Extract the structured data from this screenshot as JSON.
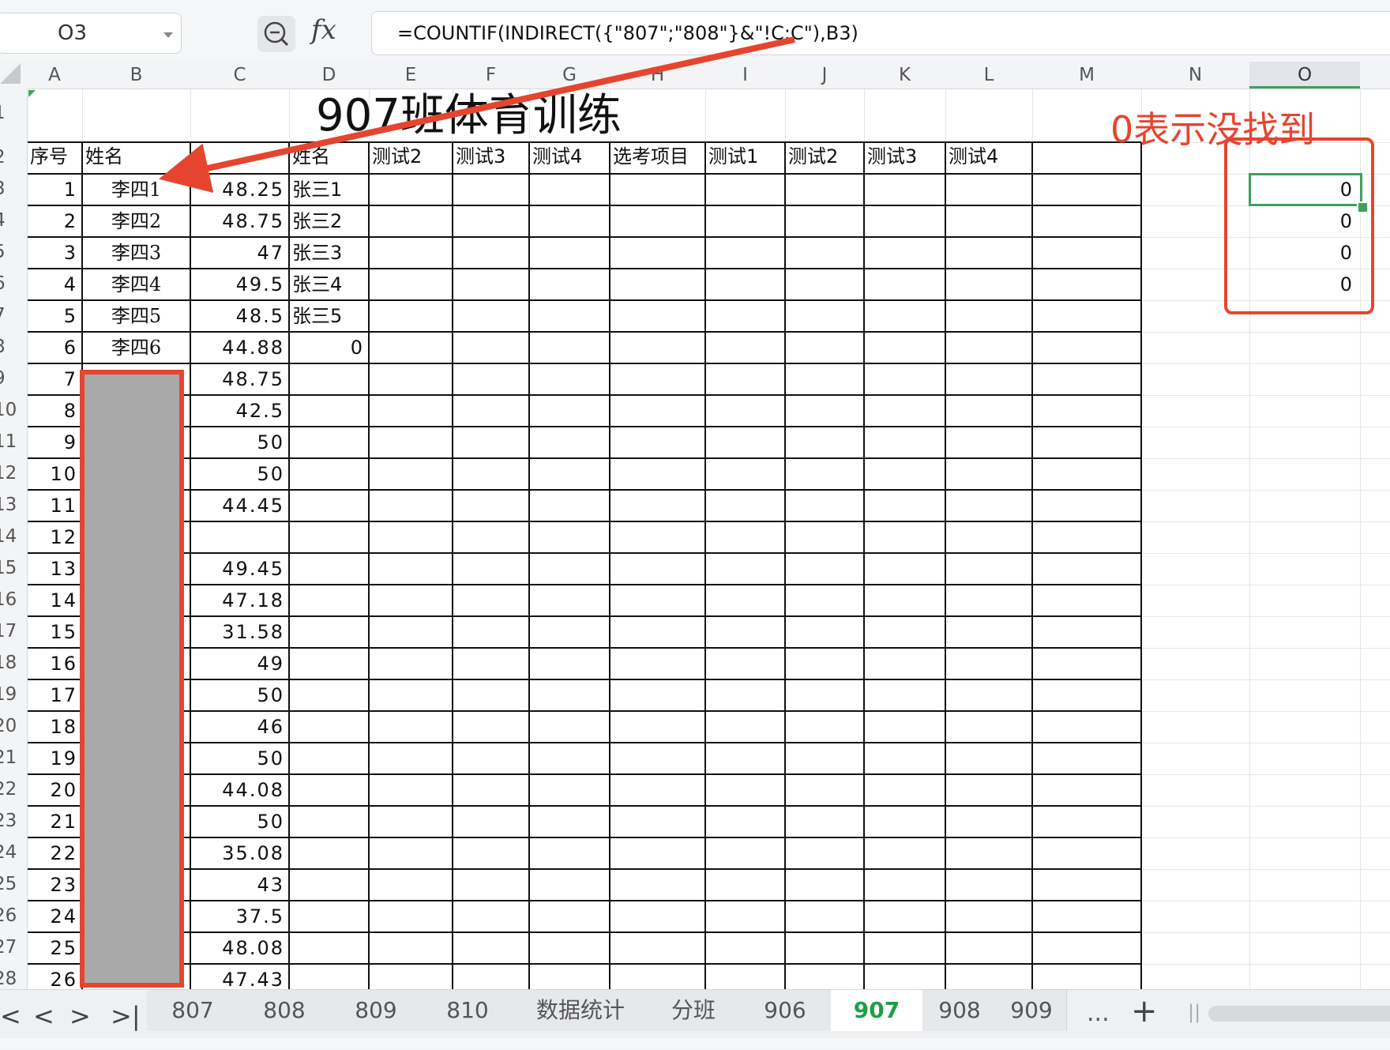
{
  "formula_bar": {
    "cell_ref": "O3",
    "fx_label": "fx",
    "formula": "=COUNTIF(INDIRECT({\"807\";\"808\"}&\"!C:C\"),B3)"
  },
  "columns": [
    "A",
    "B",
    "C",
    "D",
    "E",
    "F",
    "G",
    "H",
    "I",
    "J",
    "K",
    "L",
    "M",
    "N",
    "O"
  ],
  "selected_column": "O",
  "rows": [
    "1",
    "2",
    "3",
    "4",
    "5",
    "6",
    "7",
    "8",
    "9",
    "10",
    "11",
    "12",
    "13",
    "14",
    "15",
    "16",
    "17",
    "18",
    "19",
    "20",
    "21",
    "22",
    "23",
    "24",
    "25",
    "26",
    "27",
    "28"
  ],
  "sheet_title": "907班体育训练",
  "header_row": [
    "序号",
    "姓名",
    "",
    "姓名",
    "测试2",
    "测试3",
    "测试4",
    "选考项目",
    "测试1",
    "测试2",
    "测试3",
    "测试4"
  ],
  "serials": [
    "1",
    "2",
    "3",
    "4",
    "5",
    "6",
    "7",
    "8",
    "9",
    "10",
    "11",
    "12",
    "13",
    "14",
    "15",
    "16",
    "17",
    "18",
    "19",
    "20",
    "21",
    "22",
    "23",
    "24",
    "25",
    "26"
  ],
  "names_b": [
    "李四1",
    "李四2",
    "李四3",
    "李四4",
    "李四5",
    "李四6"
  ],
  "scores_c": [
    "48.25",
    "48.75",
    "47",
    "49.5",
    "48.5",
    "44.88",
    "48.75",
    "42.5",
    "50",
    "50",
    "44.45",
    "",
    "49.45",
    "47.18",
    "31.58",
    "49",
    "50",
    "46",
    "50",
    "44.08",
    "50",
    "35.08",
    "43",
    "37.5",
    "48.08",
    "47.43"
  ],
  "names_d": [
    "张三1",
    "张三2",
    "张三3",
    "张三4",
    "张三5",
    "0"
  ],
  "results_o": [
    "0",
    "0",
    "0",
    "0"
  ],
  "annotation": "0表示没找到",
  "sheet_tabs": [
    "807",
    "808",
    "809",
    "810",
    "数据统计",
    "分班",
    "906",
    "907",
    "908",
    "909"
  ],
  "active_tab": "907",
  "tab_more": "...",
  "tab_add": "+",
  "nav": {
    "first": "|<",
    "prev": "<",
    "next": ">",
    "last": ">|"
  }
}
